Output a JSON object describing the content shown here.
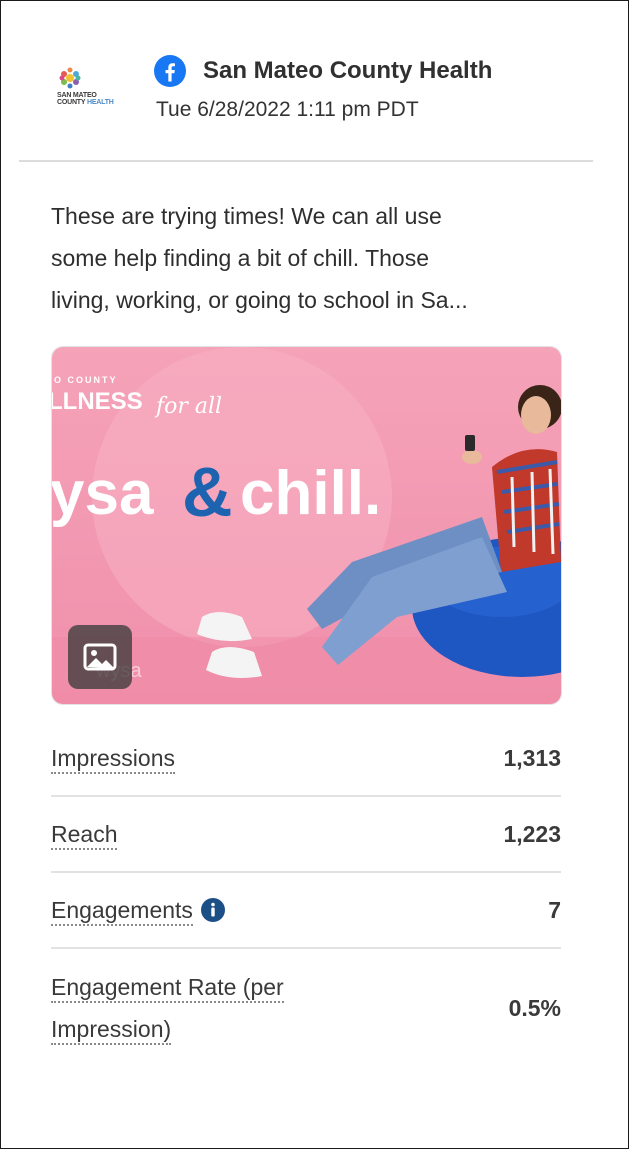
{
  "post": {
    "author": "San Mateo County Health",
    "platform_icon": "facebook-icon",
    "timestamp": "Tue 6/28/2022 1:11 pm PDT",
    "avatar": {
      "logo_line1": "SAN MATEO",
      "logo_line2a": "COUNTY",
      "logo_line2b": "HEALTH"
    },
    "text_lines": [
      "These are trying times! We can all use",
      "some help finding a bit of chill. Those",
      "living, working, or going to school in Sa..."
    ],
    "image": {
      "top_small_text": "O COUNTY",
      "wellness_text": "LLNESS",
      "for_all_text": "for all",
      "headline_left": "ysa",
      "ampersand": "&",
      "headline_right": "chill.",
      "bottom_brand": "wysa",
      "badge_icon": "image-icon",
      "bg_color": "#f39bb3",
      "accent_color": "#1d63b0"
    }
  },
  "metrics": [
    {
      "label": "Impressions",
      "value": "1,313"
    },
    {
      "label": "Reach",
      "value": "1,223"
    },
    {
      "label": "Engagements",
      "value": "7",
      "icon": "info-icon"
    },
    {
      "label": "Engagement Rate (per",
      "label2": "Impression)",
      "value": "0.5%"
    }
  ],
  "colors": {
    "facebook_blue": "#1877f2",
    "info_icon": "#1d4f87",
    "divider": "#e2e2e2"
  }
}
